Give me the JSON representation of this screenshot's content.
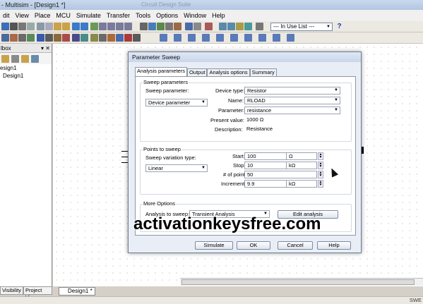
{
  "window": {
    "title": "- Multisim - [Design1 *]",
    "ghost_title": "Circuit Design Suite"
  },
  "menu": [
    "dit",
    "View",
    "Place",
    "MCU",
    "Simulate",
    "Transfer",
    "Tools",
    "Options",
    "Window",
    "Help"
  ],
  "toolbar": {
    "in_use_list": "--- In Use List ---",
    "help_icon": "?"
  },
  "left_panel": {
    "title": "lbox",
    "tree": [
      "esign1",
      "Design1"
    ],
    "tabs": [
      "Visibility",
      "Project View"
    ]
  },
  "doc_tab": "Design1 *",
  "status": {
    "right": "SWE"
  },
  "dialog": {
    "title": "Parameter Sweep",
    "tabs": [
      "Analysis parameters",
      "Output",
      "Analysis options",
      "Summary"
    ],
    "sweep_parameters": {
      "group_label": "Sweep parameters",
      "sweep_parameter_label": "Sweep parameter:",
      "sweep_parameter_value": "Device parameter",
      "device_type_label": "Device type:",
      "device_type_value": "Resistor",
      "name_label": "Name:",
      "name_value": "RLOAD",
      "parameter_label": "Parameter:",
      "parameter_value": "resistance",
      "present_value_label": "Present value:",
      "present_value": "1000 Ω",
      "description_label": "Description:",
      "description_value": "Resistance"
    },
    "points_to_sweep": {
      "group_label": "Points to sweep",
      "variation_label": "Sweep variation type:",
      "variation_value": "Linear",
      "start_label": "Start:",
      "start_value": "100",
      "start_unit": "Ω",
      "stop_label": "Stop:",
      "stop_value": "10",
      "stop_unit": "kΩ",
      "points_label": "# of points:",
      "points_value": "50",
      "increment_label": "Increment:",
      "increment_value": "9.9",
      "increment_unit": "kΩ"
    },
    "more_options": {
      "group_label": "More Options",
      "analysis_label": "Analysis to sweep:",
      "analysis_value": "Transient Analysis",
      "edit_button": "Edit analysis"
    },
    "buttons": {
      "simulate": "Simulate",
      "ok": "OK",
      "cancel": "Cancel",
      "help": "Help"
    }
  },
  "watermark": "activationkeysfree.com"
}
